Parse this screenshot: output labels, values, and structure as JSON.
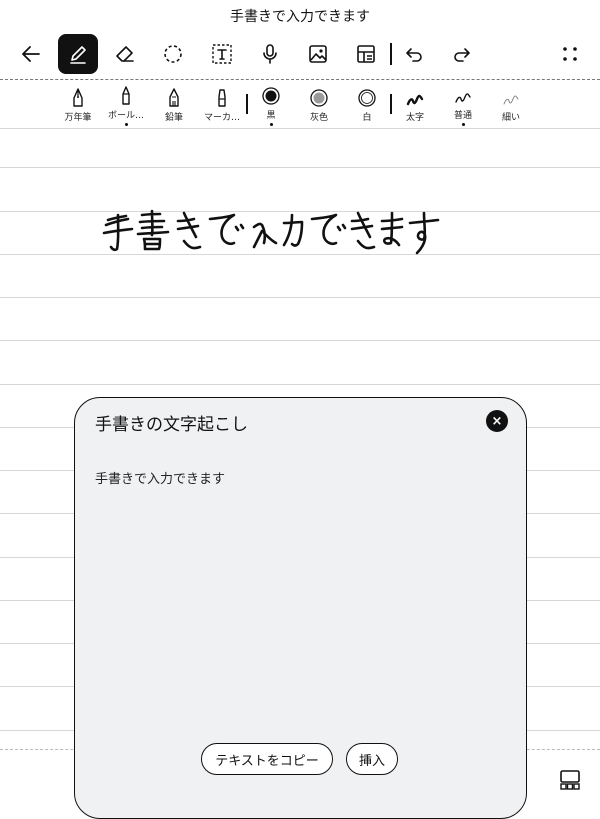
{
  "title": "手書きで入力できます",
  "toolbar": {
    "buttons": [
      {
        "name": "back",
        "icon": "arrow-left-icon"
      },
      {
        "name": "pen",
        "icon": "pen-icon",
        "active": true
      },
      {
        "name": "eraser",
        "icon": "eraser-icon"
      },
      {
        "name": "lasso",
        "icon": "lasso-select-icon"
      },
      {
        "name": "text",
        "icon": "text-box-icon"
      },
      {
        "name": "voice",
        "icon": "microphone-icon"
      },
      {
        "name": "image",
        "icon": "image-icon"
      },
      {
        "name": "template",
        "icon": "layout-icon"
      },
      {
        "name": "undo",
        "icon": "undo-icon"
      },
      {
        "name": "redo",
        "icon": "redo-icon"
      },
      {
        "name": "more",
        "icon": "grid-dots-icon"
      }
    ]
  },
  "pen_types": [
    {
      "label": "万年筆",
      "icon": "fountain-pen-icon",
      "selected": false
    },
    {
      "label": "ボール…",
      "icon": "ballpoint-pen-icon",
      "selected": true
    },
    {
      "label": "鉛筆",
      "icon": "pencil-icon",
      "selected": false
    },
    {
      "label": "マーカ…",
      "icon": "marker-icon",
      "selected": false
    }
  ],
  "colors": [
    {
      "label": "黒",
      "value": "#111111",
      "selected": true
    },
    {
      "label": "灰色",
      "value": "#9a9a9a",
      "selected": false
    },
    {
      "label": "白",
      "value": "#ffffff",
      "selected": false
    }
  ],
  "widths": [
    {
      "label": "太字",
      "selected": false
    },
    {
      "label": "普通",
      "selected": true
    },
    {
      "label": "細い",
      "selected": false
    }
  ],
  "handwriting_text": "手書きで入力できます",
  "panel": {
    "title": "手書きの文字起こし",
    "close_label": "×",
    "recognized_text": "手書きで入力できます",
    "copy_label": "テキストをコピー",
    "insert_label": "挿入"
  },
  "colors_theme": {
    "accent": "#111111",
    "panel_bg": "#f0f1f3",
    "rule_line": "#d7d7d7"
  }
}
